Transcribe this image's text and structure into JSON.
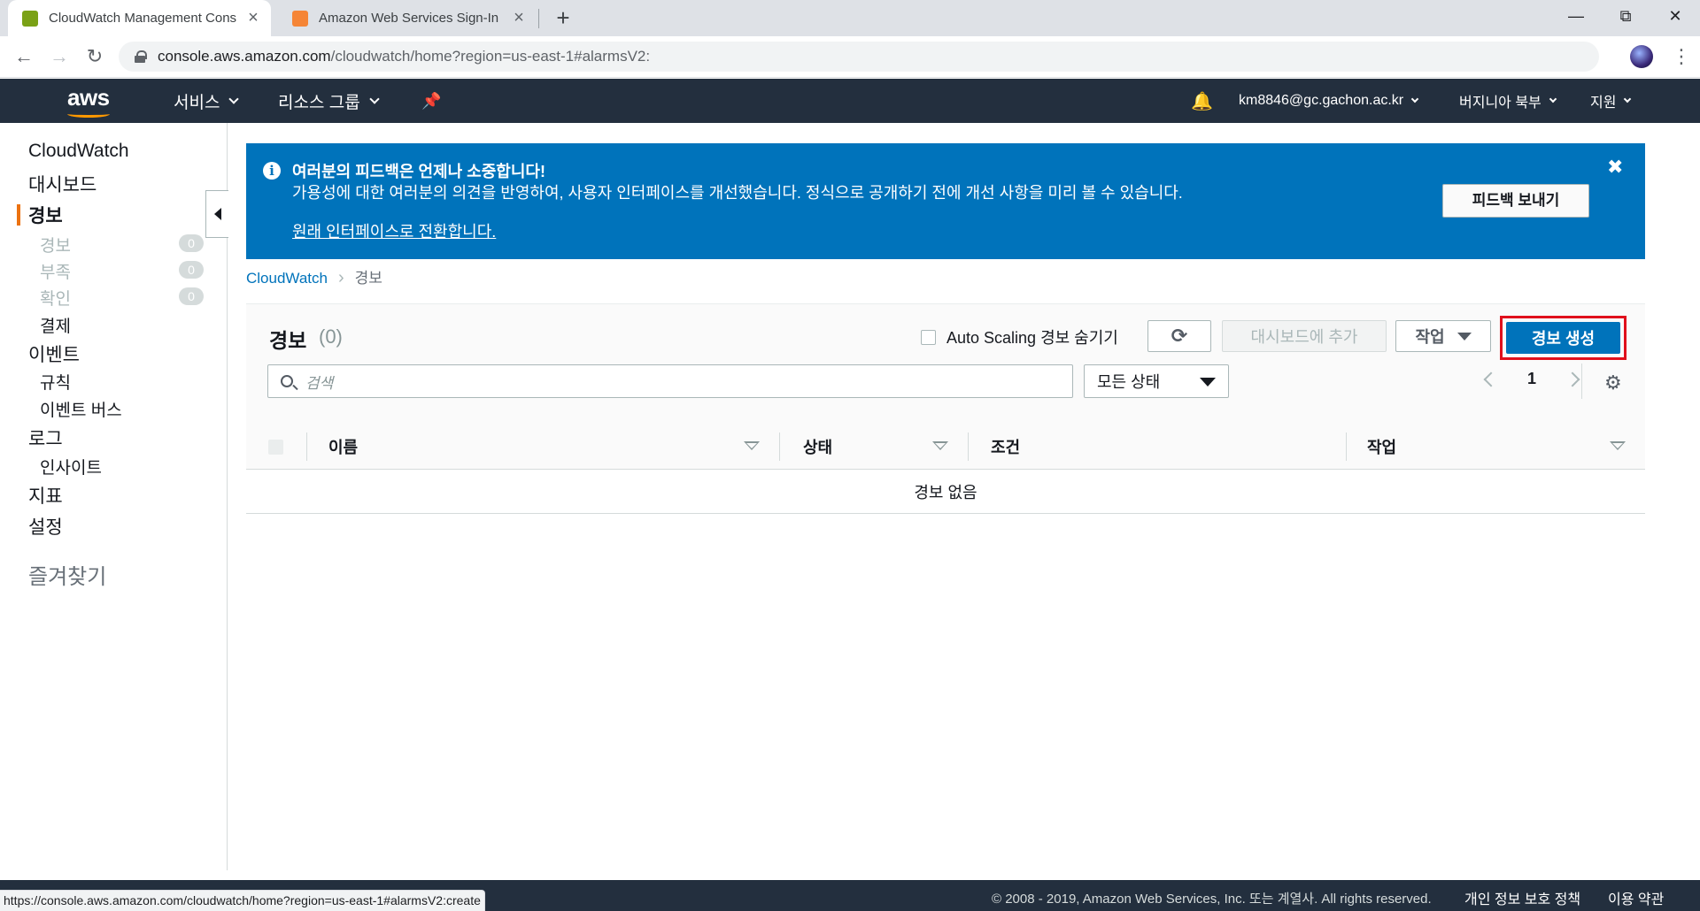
{
  "browser": {
    "tabs": [
      {
        "title": "CloudWatch Management Cons",
        "favicon_color": "#7aa116"
      },
      {
        "title": "Amazon Web Services Sign-In",
        "favicon_color": "#f58536"
      }
    ],
    "url_host": "console.aws.amazon.com",
    "url_path": "/cloudwatch/home?region=us-east-1#alarmsV2:",
    "status_url": "https://console.aws.amazon.com/cloudwatch/home?region=us-east-1#alarmsV2:create"
  },
  "awsnav": {
    "logo": "aws",
    "services": "서비스",
    "resource_groups": "리소스 그룹",
    "account": "km8846@gc.gachon.ac.kr",
    "region": "버지니아 북부",
    "support": "지원"
  },
  "sidebar": {
    "service": "CloudWatch",
    "dashboard": "대시보드",
    "alarms": "경보",
    "alarm_sub": [
      {
        "label": "경보",
        "count": "0"
      },
      {
        "label": "부족",
        "count": "0"
      },
      {
        "label": "확인",
        "count": "0"
      }
    ],
    "billing": "결제",
    "events": "이벤트",
    "rules": "규칙",
    "event_bus": "이벤트 버스",
    "logs": "로그",
    "insights": "인사이트",
    "metrics": "지표",
    "settings": "설정",
    "favorites": "즐겨찾기"
  },
  "banner": {
    "title": "여러분의 피드백은 언제나 소중합니다!",
    "body": "가용성에 대한 여러분의 의견을 반영하여, 사용자 인터페이스를 개선했습니다. 정식으로 공개하기 전에 개선 사항을 미리 볼 수 있습니다.",
    "link": "원래 인터페이스로 전환합니다.",
    "feedback_button": "피드백 보내기",
    "close": "✖"
  },
  "breadcrumb": {
    "root": "CloudWatch",
    "current": "경보"
  },
  "alarms": {
    "title": "경보",
    "count": "(0)",
    "hide_autoscaling": "Auto Scaling 경보 숨기기",
    "add_to_dashboard": "대시보드에 추가",
    "actions": "작업",
    "create_alarm": "경보 생성",
    "search_placeholder": "검색",
    "state_filter": "모든 상태",
    "page": "1",
    "columns": [
      "이름",
      "상태",
      "조건",
      "작업"
    ],
    "empty": "경보 없음"
  },
  "footer": {
    "copyright": "© 2008 - 2019, Amazon Web Services, Inc. 또는 계열사. All rights reserved.",
    "privacy": "개인 정보 보호 정책",
    "terms": "이용 약관"
  }
}
